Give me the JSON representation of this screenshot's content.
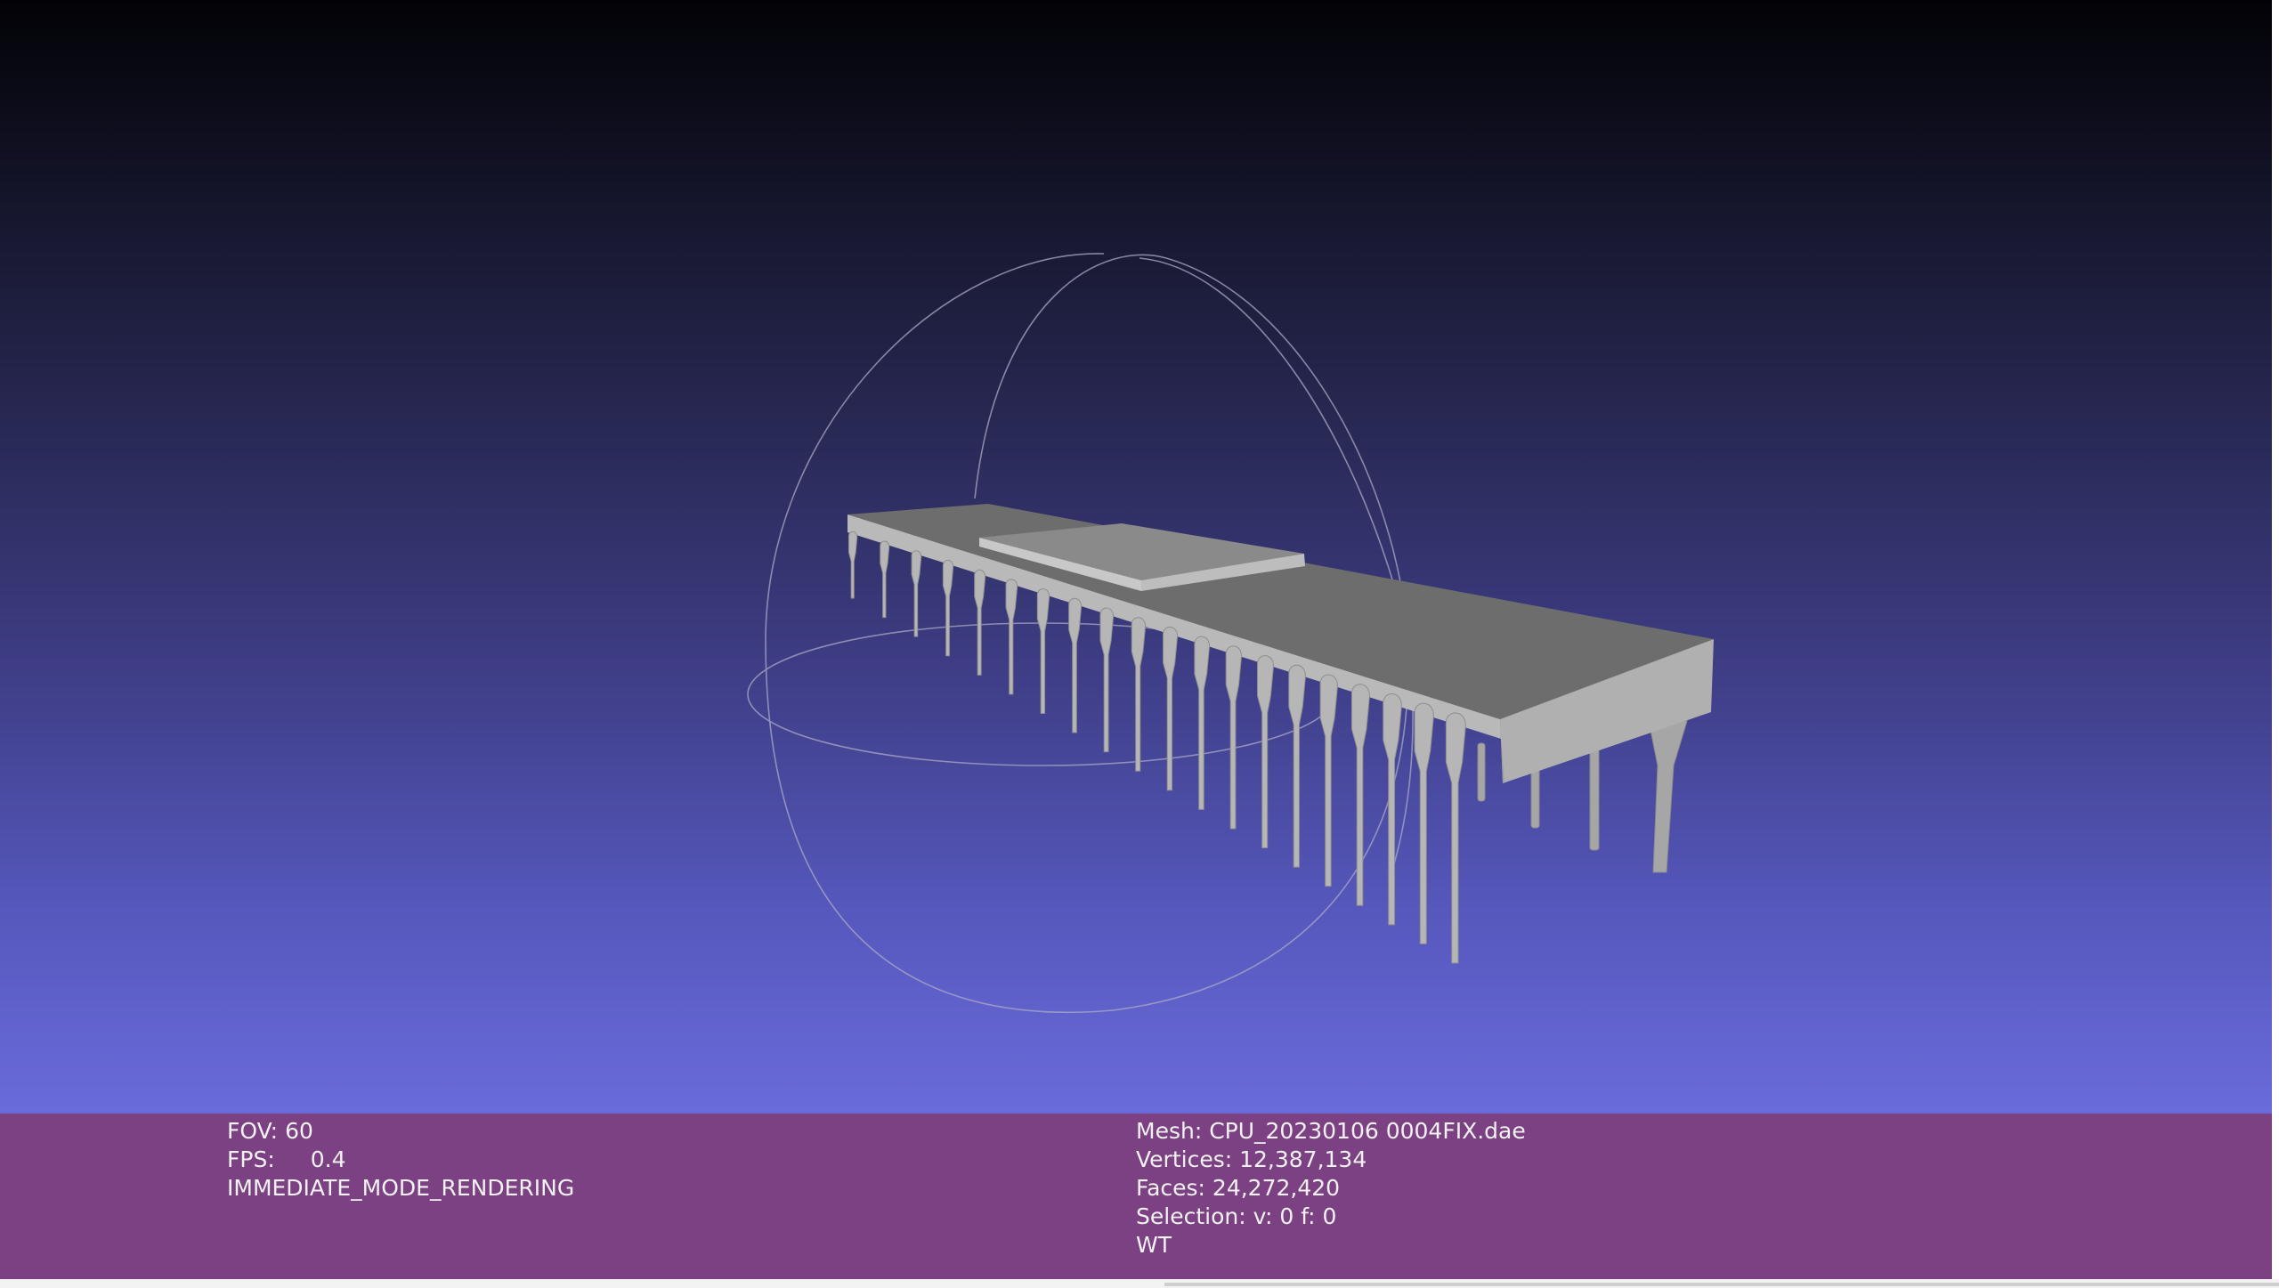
{
  "viewport": {
    "object": "cpu-chip-mesh",
    "gradient_top": "#020206",
    "gradient_bottom": "#6a6bdb"
  },
  "info_left": {
    "fov_label": "FOV:",
    "fov_value": "60",
    "fps_label": "FPS:",
    "fps_value": "0.4",
    "render_mode": "IMMEDIATE_MODE_RENDERING"
  },
  "info_right": {
    "mesh": "Mesh: CPU_20230106 0004FIX.dae",
    "vertices": "Vertices: 12,387,134",
    "faces": "Faces: 24,272,420",
    "selection": "Selection: v: 0 f: 0",
    "mode": "WT"
  },
  "colors": {
    "panel_bg": "#7c4182",
    "panel_text": "#f2f2f2",
    "chip_top": "#6d6d6d",
    "chip_side": "#b3b3b3"
  }
}
